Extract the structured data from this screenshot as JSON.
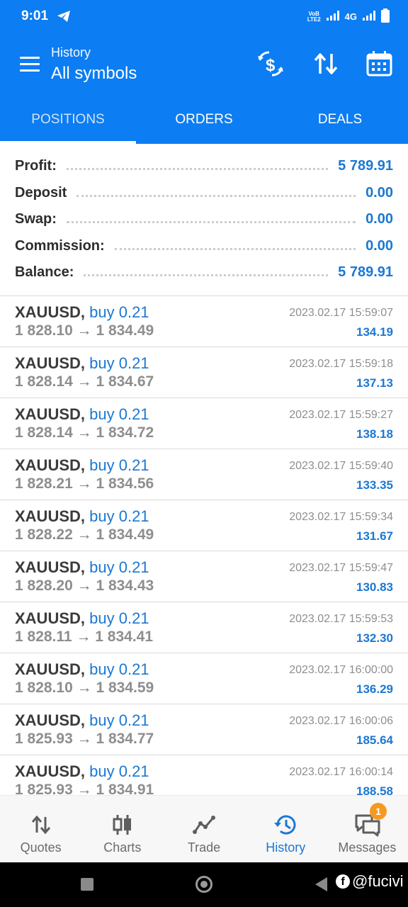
{
  "status_bar": {
    "time": "9:01",
    "volte_label_1": "VoB",
    "volte_label_2": "LTE2",
    "network": "4G",
    "icons": [
      "telegram-icon",
      "signal-icon",
      "battery-icon"
    ]
  },
  "header": {
    "subtitle": "History",
    "title": "All symbols",
    "actions": [
      "currency-exchange-icon",
      "sort-icon",
      "calendar-icon"
    ]
  },
  "tabs": [
    {
      "label": "POSITIONS",
      "active": true
    },
    {
      "label": "ORDERS",
      "active": false
    },
    {
      "label": "DEALS",
      "active": false
    }
  ],
  "summary": {
    "profit": {
      "label": "Profit:",
      "value": "5 789.91"
    },
    "deposit": {
      "label": "Deposit",
      "value": "0.00"
    },
    "swap": {
      "label": "Swap:",
      "value": "0.00"
    },
    "commission": {
      "label": "Commission:",
      "value": "0.00"
    },
    "balance": {
      "label": "Balance:",
      "value": "5 789.91"
    }
  },
  "deals": [
    {
      "symbol": "XAUUSD,",
      "action": "buy 0.21",
      "open": "1 828.10",
      "arrow": "→",
      "close": "1 834.49",
      "time": "2023.02.17 15:59:07",
      "profit": "134.19"
    },
    {
      "symbol": "XAUUSD,",
      "action": "buy 0.21",
      "open": "1 828.14",
      "arrow": "→",
      "close": "1 834.67",
      "time": "2023.02.17 15:59:18",
      "profit": "137.13"
    },
    {
      "symbol": "XAUUSD,",
      "action": "buy 0.21",
      "open": "1 828.14",
      "arrow": "→",
      "close": "1 834.72",
      "time": "2023.02.17 15:59:27",
      "profit": "138.18"
    },
    {
      "symbol": "XAUUSD,",
      "action": "buy 0.21",
      "open": "1 828.21",
      "arrow": "→",
      "close": "1 834.56",
      "time": "2023.02.17 15:59:40",
      "profit": "133.35"
    },
    {
      "symbol": "XAUUSD,",
      "action": "buy 0.21",
      "open": "1 828.22",
      "arrow": "→",
      "close": "1 834.49",
      "time": "2023.02.17 15:59:34",
      "profit": "131.67"
    },
    {
      "symbol": "XAUUSD,",
      "action": "buy 0.21",
      "open": "1 828.20",
      "arrow": "→",
      "close": "1 834.43",
      "time": "2023.02.17 15:59:47",
      "profit": "130.83"
    },
    {
      "symbol": "XAUUSD,",
      "action": "buy 0.21",
      "open": "1 828.11",
      "arrow": "→",
      "close": "1 834.41",
      "time": "2023.02.17 15:59:53",
      "profit": "132.30"
    },
    {
      "symbol": "XAUUSD,",
      "action": "buy 0.21",
      "open": "1 828.10",
      "arrow": "→",
      "close": "1 834.59",
      "time": "2023.02.17 16:00:00",
      "profit": "136.29"
    },
    {
      "symbol": "XAUUSD,",
      "action": "buy 0.21",
      "open": "1 825.93",
      "arrow": "→",
      "close": "1 834.77",
      "time": "2023.02.17 16:00:06",
      "profit": "185.64"
    },
    {
      "symbol": "XAUUSD,",
      "action": "buy 0.21",
      "open": "1 825.93",
      "arrow": "→",
      "close": "1 834.91",
      "time": "2023.02.17 16:00:14",
      "profit": "188.58"
    }
  ],
  "bottom_nav": {
    "quotes": "Quotes",
    "charts": "Charts",
    "trade": "Trade",
    "history": "History",
    "messages": "Messages",
    "messages_badge": "1",
    "active": "history"
  },
  "watermark": {
    "fb": "f",
    "text": "@fucivi"
  },
  "colors": {
    "brand_blue": "#0c7df2",
    "value_blue": "#1b78d3",
    "badge_orange": "#f59a20"
  }
}
